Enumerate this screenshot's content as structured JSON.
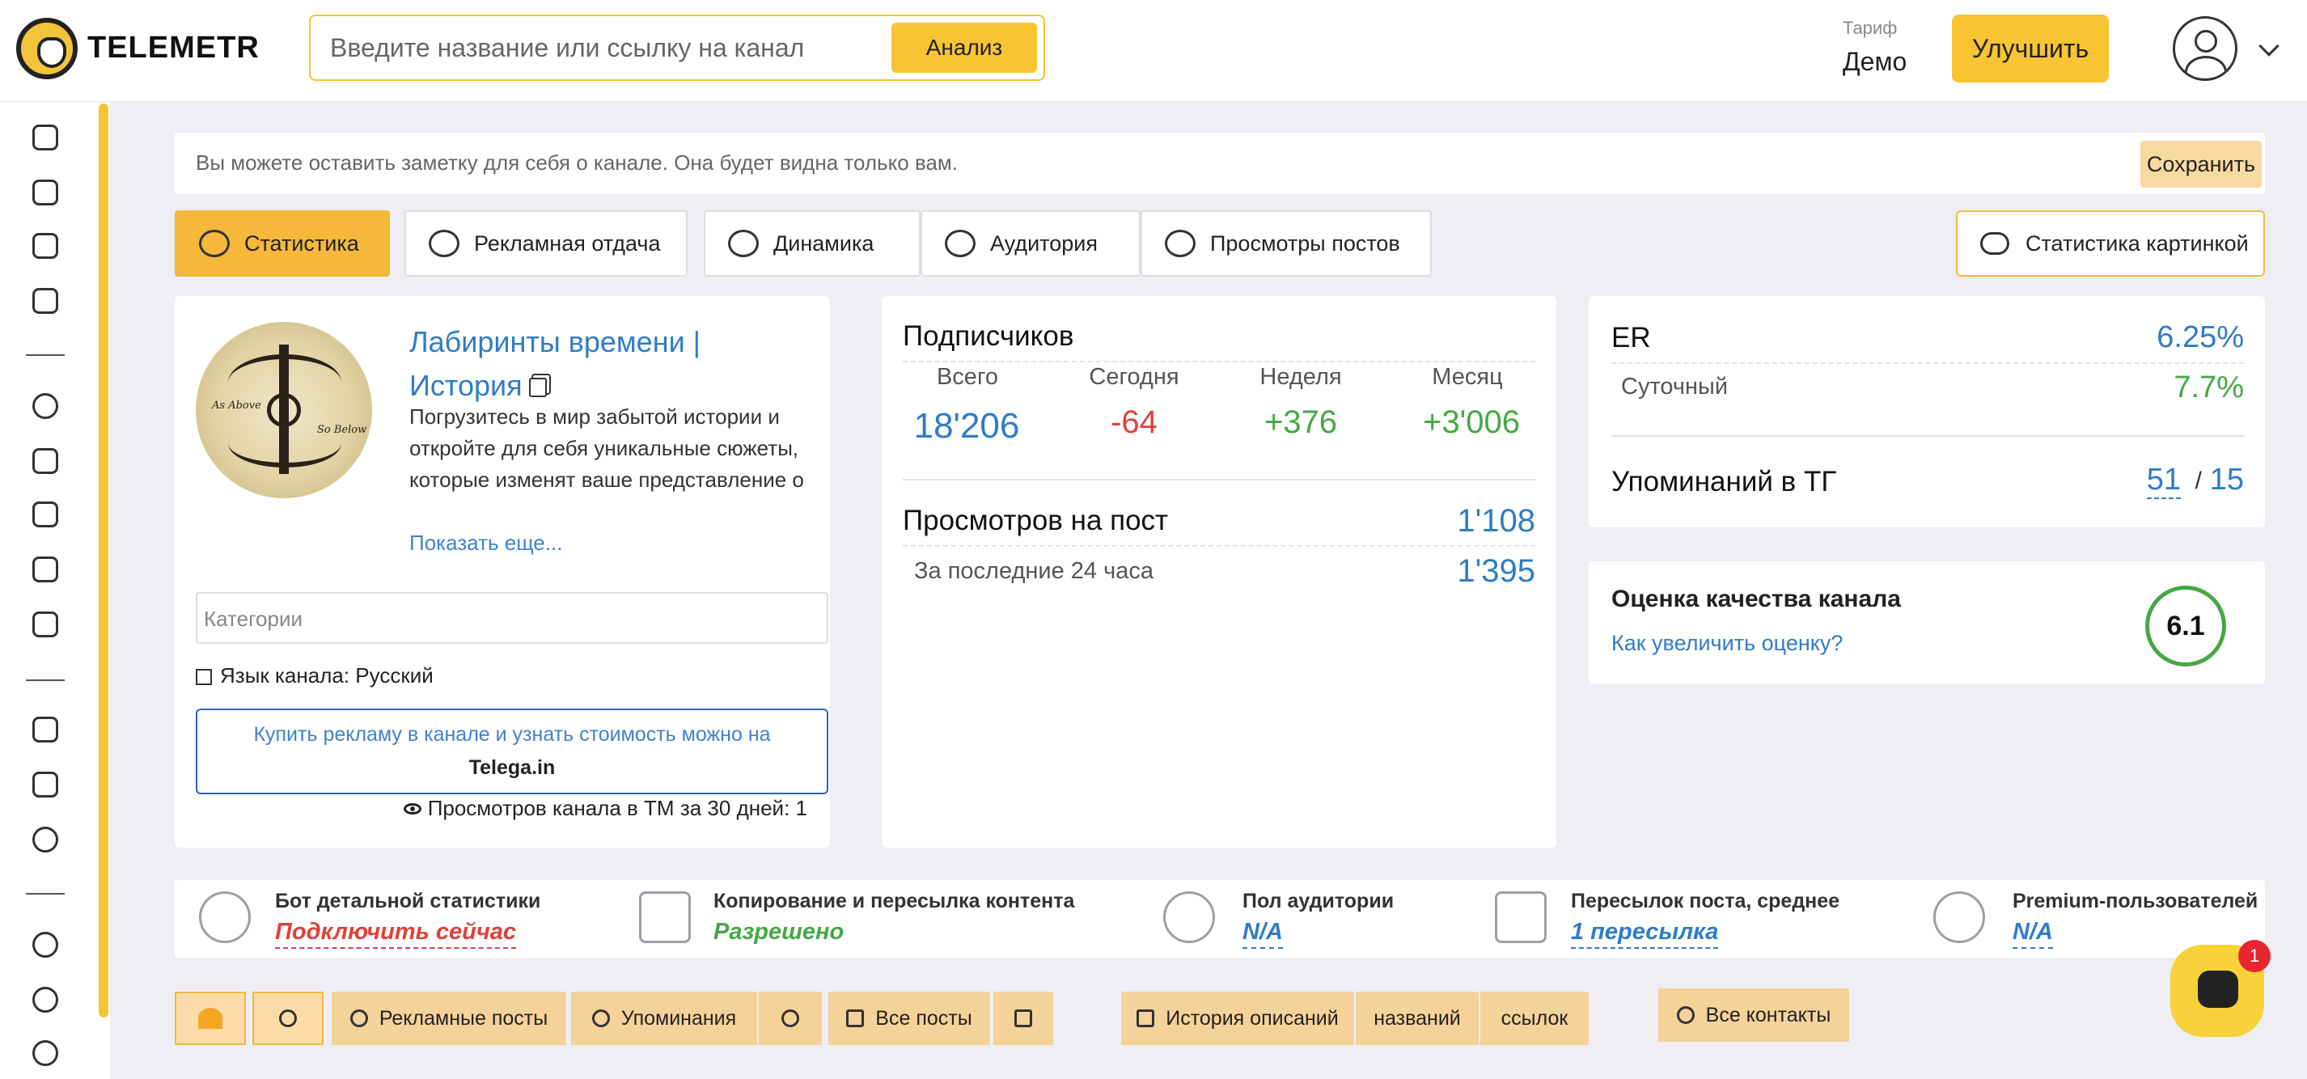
{
  "header": {
    "brand": "TELEMETR",
    "search_placeholder": "Введите название или ссылку на канал",
    "analyze_label": "Анализ",
    "tariff_label": "Тариф",
    "tariff_value": "Демо",
    "upgrade_label": "Улучшить"
  },
  "note": {
    "text": "Вы можете оставить заметку для себя о канале. Она будет видна только вам.",
    "save_label": "Сохранить"
  },
  "tabs": [
    {
      "label": "Статистика",
      "icon": "speedometer-icon"
    },
    {
      "label": "Рекламная отдача",
      "icon": "recycle-icon"
    },
    {
      "label": "Динамика",
      "icon": "line-chart-icon"
    },
    {
      "label": "Аудитория",
      "icon": "users-icon"
    },
    {
      "label": "Просмотры постов",
      "icon": "eye-icon"
    }
  ],
  "stats_image_label": "Статистика картинкой",
  "channel": {
    "title_line1": "Лабиринты времени |",
    "title_line2": "История",
    "image_text_left": "As Above",
    "image_text_right": "So Below",
    "description": "Погрузитесь в мир забытой истории и откройте для себя уникальные сюжеты, которые изменят ваше представление о времени",
    "show_more": "Показать еще...",
    "categories_placeholder": "Категории",
    "language": "Язык канала: Русский",
    "buy_line1": "Купить рекламу в канале и узнать стоимость можно на",
    "buy_line2": "Telega.in",
    "views30": "Просмотров канала в ТМ за 30 дней: 1"
  },
  "subscribers": {
    "title": "Подписчиков",
    "cols": [
      {
        "label": "Всего",
        "value": "18'206"
      },
      {
        "label": "Сегодня",
        "value": "-64"
      },
      {
        "label": "Неделя",
        "value": "+376"
      },
      {
        "label": "Месяц",
        "value": "+3'006"
      }
    ],
    "views_title": "Просмотров на пост",
    "views_value": "1'108",
    "views24_label": "За последние 24 часа",
    "views24_value": "1'395"
  },
  "er": {
    "label": "ER",
    "value": "6.25%",
    "daily_label": "Суточный",
    "daily_value": "7.7%",
    "mentions_label": "Упоминаний в ТГ",
    "mentions_a": "51",
    "mentions_sep": "/",
    "mentions_b": "15"
  },
  "quality": {
    "title": "Оценка качества канала",
    "link": "Как увеличить оценку?",
    "score": "6.1"
  },
  "info": [
    {
      "title": "Бот детальной статистики",
      "value": "Подключить сейчас",
      "icon": "sad-face-icon"
    },
    {
      "title": "Копирование и пересылка контента",
      "value": "Разрешено",
      "icon": "forward-clipboard-icon"
    },
    {
      "title": "Пол аудитории",
      "value": "N/A",
      "icon": "users-icon"
    },
    {
      "title": "Пересылок поста, среднее",
      "value": "1 пересылка",
      "icon": "megaphone-icon"
    },
    {
      "title": "Premium-пользователей",
      "value": "N/A",
      "icon": "star-icon"
    }
  ],
  "bottom": {
    "ad_posts": "Рекламные посты",
    "mentions": "Упоминания",
    "all_posts": "Все посты",
    "history_desc": "История описаний",
    "names": "названий",
    "links": "ссылок",
    "all_contacts": "Все контакты"
  },
  "chat_badge": "1",
  "colors": {
    "accent": "#f8c432",
    "link": "#2f7cc7",
    "negative": "#e0403a",
    "positive": "#45a845"
  }
}
